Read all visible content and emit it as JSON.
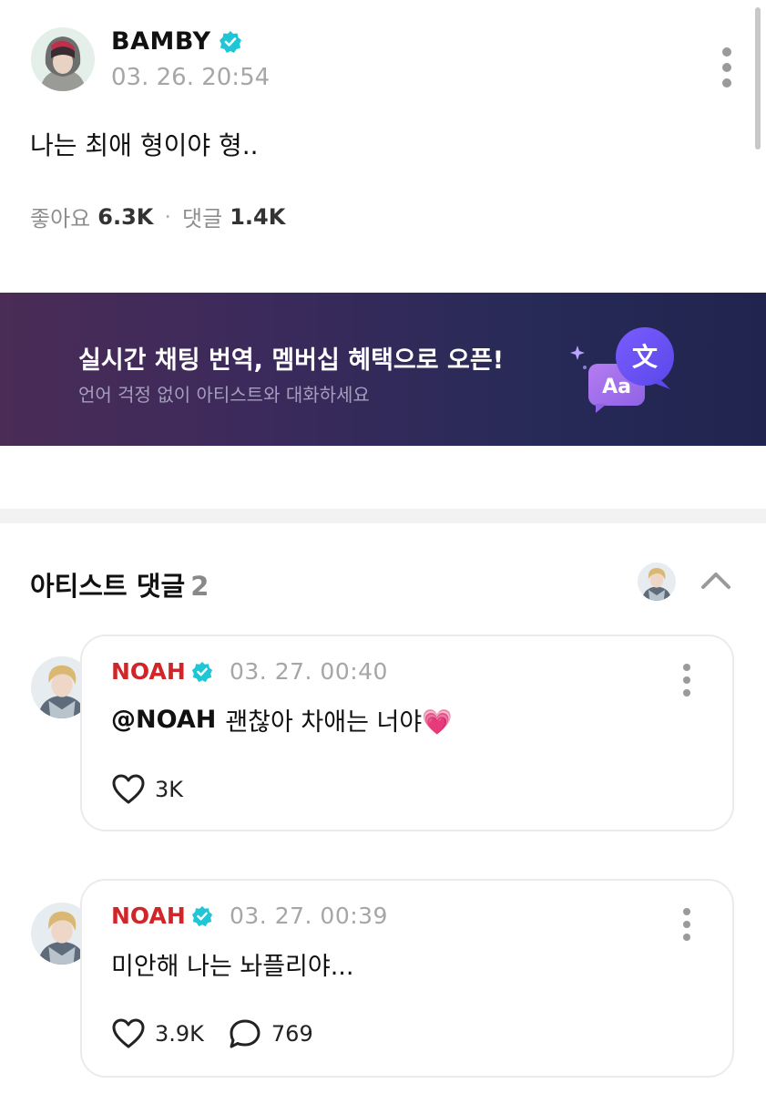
{
  "post": {
    "author": "BAMBY",
    "time": "03. 26. 20:54",
    "text": "나는 최애 형이야 형..",
    "likes_label": "좋아요",
    "likes_count": "6.3K",
    "comments_label": "댓글",
    "comments_count": "1.4K"
  },
  "banner": {
    "title": "실시간 채팅 번역, 멤버십 혜택으로 오픈!",
    "subtitle": "언어 걱정 없이 아티스트와 대화하세요",
    "badge_text": "文",
    "badge_latin": "Aa"
  },
  "artist_comments": {
    "title": "아티스트 댓글",
    "count": "2"
  },
  "comments": [
    {
      "author": "NOAH",
      "time": "03. 27. 00:40",
      "mention": "@NOAH",
      "text": "괜찮아 차애는 너야💗",
      "likes": "3K"
    },
    {
      "author": "NOAH",
      "time": "03. 27. 00:39",
      "text": "미안해 나는 놔플리야...",
      "likes": "3.9K",
      "replies": "769"
    }
  ],
  "colors": {
    "verified": "#1fc6d6",
    "artist_name": "#d0262a",
    "banner_start": "#4a2c56",
    "banner_end": "#20244e"
  },
  "icons": [
    "verified-badge-icon",
    "more-vertical-icon",
    "chevron-up-icon",
    "heart-icon",
    "comment-bubble-icon",
    "translate-icon"
  ]
}
